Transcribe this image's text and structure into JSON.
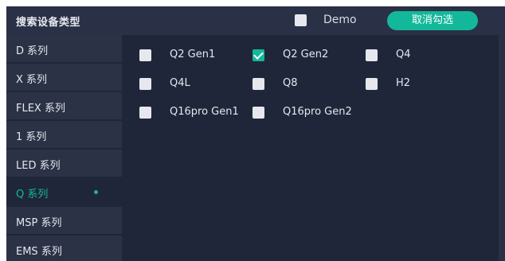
{
  "header": {
    "title": "搜索设备类型",
    "demo_label": "Demo",
    "demo_checked": false,
    "deselect_label": "取消勾选"
  },
  "sidebar": {
    "items": [
      {
        "label": "D 系列",
        "active": false
      },
      {
        "label": "X 系列",
        "active": false
      },
      {
        "label": "FLEX 系列",
        "active": false
      },
      {
        "label": "1 系列",
        "active": false
      },
      {
        "label": "LED 系列",
        "active": false
      },
      {
        "label": "Q 系列",
        "active": true
      },
      {
        "label": "MSP 系列",
        "active": false
      },
      {
        "label": "EMS 系列",
        "active": false
      }
    ]
  },
  "options": [
    {
      "label": "Q2 Gen1",
      "checked": false
    },
    {
      "label": "Q2 Gen2",
      "checked": true
    },
    {
      "label": "Q4",
      "checked": false
    },
    {
      "label": "Q4L",
      "checked": false
    },
    {
      "label": "Q8",
      "checked": false
    },
    {
      "label": "H2",
      "checked": false
    },
    {
      "label": "Q16pro Gen1",
      "checked": false
    },
    {
      "label": "Q16pro Gen2",
      "checked": false
    }
  ],
  "colors": {
    "accent": "#13b89a",
    "panel_bg": "#20263a",
    "sidebar_bg": "#2c3246",
    "header_bg": "#2a3045",
    "checkbox_bg": "#e6e8ee"
  }
}
